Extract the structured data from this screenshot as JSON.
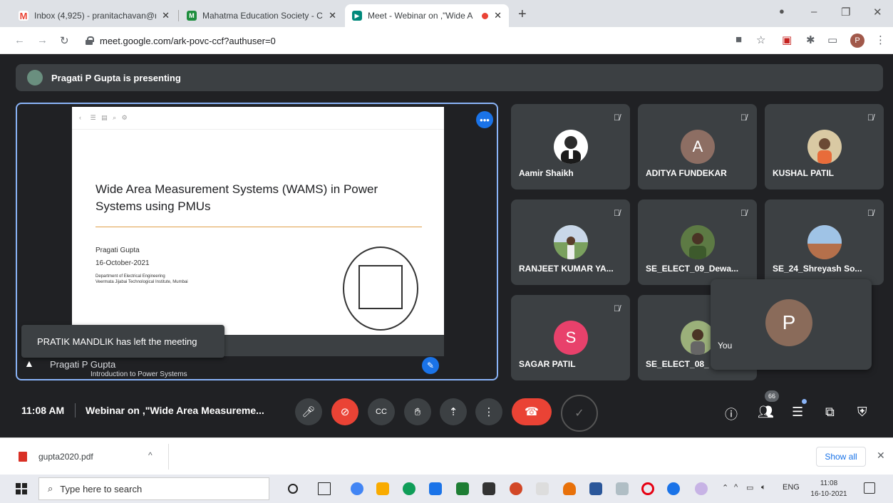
{
  "browser": {
    "tabs": [
      {
        "title": "Inbox (4,925) - pranitachavan@n",
        "icon": "gmail-icon"
      },
      {
        "title": "Mahatma Education Society - Cl",
        "icon": "classroom-icon"
      },
      {
        "title": "Meet - Webinar on ,\"Wide A",
        "icon": "meet-icon",
        "active": true
      }
    ],
    "new_tab": "+",
    "url": "meet.google.com/ark-povc-ccf?authuser=0",
    "profile_initial": "P"
  },
  "meet": {
    "presenting_text": "Pragati P Gupta is presenting",
    "slide": {
      "title": "Wide Area Measurement Systems (WAMS) in Power Systems using PMUs",
      "author": "Pragati Gupta",
      "date": "16-October-2021",
      "department": "Department of Electrical Engineering",
      "institute": "Veermata Jijabai Technological Institute, Mumbai"
    },
    "presenter_name": "Pragati P Gupta",
    "slide_subtext": "Introduction to Power Systems",
    "toast": "PRATIK MANDLIK has left the meeting",
    "participants": [
      {
        "name": "Aamir Shaikh",
        "avatar_color": "#ffffff",
        "initial": ""
      },
      {
        "name": "ADITYA FUNDEKAR",
        "avatar_color": "#8d6e63",
        "initial": "A"
      },
      {
        "name": "KUSHAL PATIL",
        "avatar_color": "#d9c9a3",
        "initial": ""
      },
      {
        "name": "RANJEET KUMAR YA...",
        "avatar_color": "#7aa05e",
        "initial": ""
      },
      {
        "name": "SE_ELECT_09_Dewa...",
        "avatar_color": "#5d7a44",
        "initial": ""
      },
      {
        "name": "SE_24_Shreyash So...",
        "avatar_color": "#a47054",
        "initial": ""
      },
      {
        "name": "SAGAR PATIL",
        "avatar_color": "#e8416b",
        "initial": "S"
      },
      {
        "name": "SE_ELECT_08_",
        "avatar_color": "#9bb07a",
        "initial": ""
      }
    ],
    "self_tile": {
      "label": "You",
      "initial": "P"
    },
    "controls": {
      "time": "11:08 AM",
      "meeting_title": "Webinar on ,\"Wide Area Measureme...",
      "participant_count": "66"
    }
  },
  "downloads": {
    "file": "gupta2020.pdf",
    "show_all": "Show all"
  },
  "taskbar": {
    "search_placeholder": "Type here to search",
    "language": "ENG",
    "time": "11:08",
    "date": "16-10-2021"
  }
}
